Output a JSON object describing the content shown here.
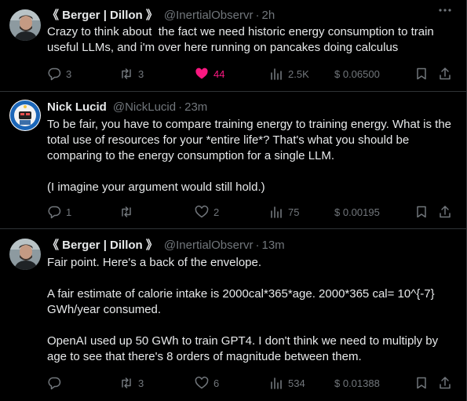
{
  "tweets": [
    {
      "name": "《 Berger | Dillon 》",
      "handle": "@InertialObservr",
      "time": "2h",
      "text": [
        "Crazy to think about  the fact we need historic energy consumption to train useful LLMs, and i'm over here running on pancakes doing calculus"
      ],
      "replies": "3",
      "retweets": "3",
      "likes": "44",
      "views": "2.5K",
      "tip": "$ 0.06500",
      "liked": true
    },
    {
      "name": "Nick Lucid",
      "handle": "@NickLucid",
      "time": "23m",
      "text": [
        "To be fair, you have to compare training energy to training energy. What is the total use of resources for your *entire life*? That's what you should be comparing to the energy consumption for a single LLM.",
        "(I imagine your argument would still hold.)"
      ],
      "replies": "1",
      "retweets": "",
      "likes": "2",
      "views": "75",
      "tip": "$ 0.00195",
      "liked": false
    },
    {
      "name": "《 Berger | Dillon 》",
      "handle": "@InertialObservr",
      "time": "13m",
      "text": [
        "Fair point. Here's a back of the envelope.",
        "A fair estimate of calorie intake is 2000cal*365*age. 2000*365 cal= 10^{-7} GWh/year consumed.",
        "OpenAI used up 50 GWh to train GPT4. I don't think we need to multiply by age to see that there's 8 orders of magnitude between them."
      ],
      "replies": "",
      "retweets": "3",
      "likes": "6",
      "views": "534",
      "tip": "$ 0.01388",
      "liked": false
    }
  ],
  "separator": "·",
  "colors": {
    "background": "#000000",
    "text": "#e7e9ea",
    "muted": "#71767b",
    "like": "#f91880",
    "divider": "#2f3336"
  }
}
